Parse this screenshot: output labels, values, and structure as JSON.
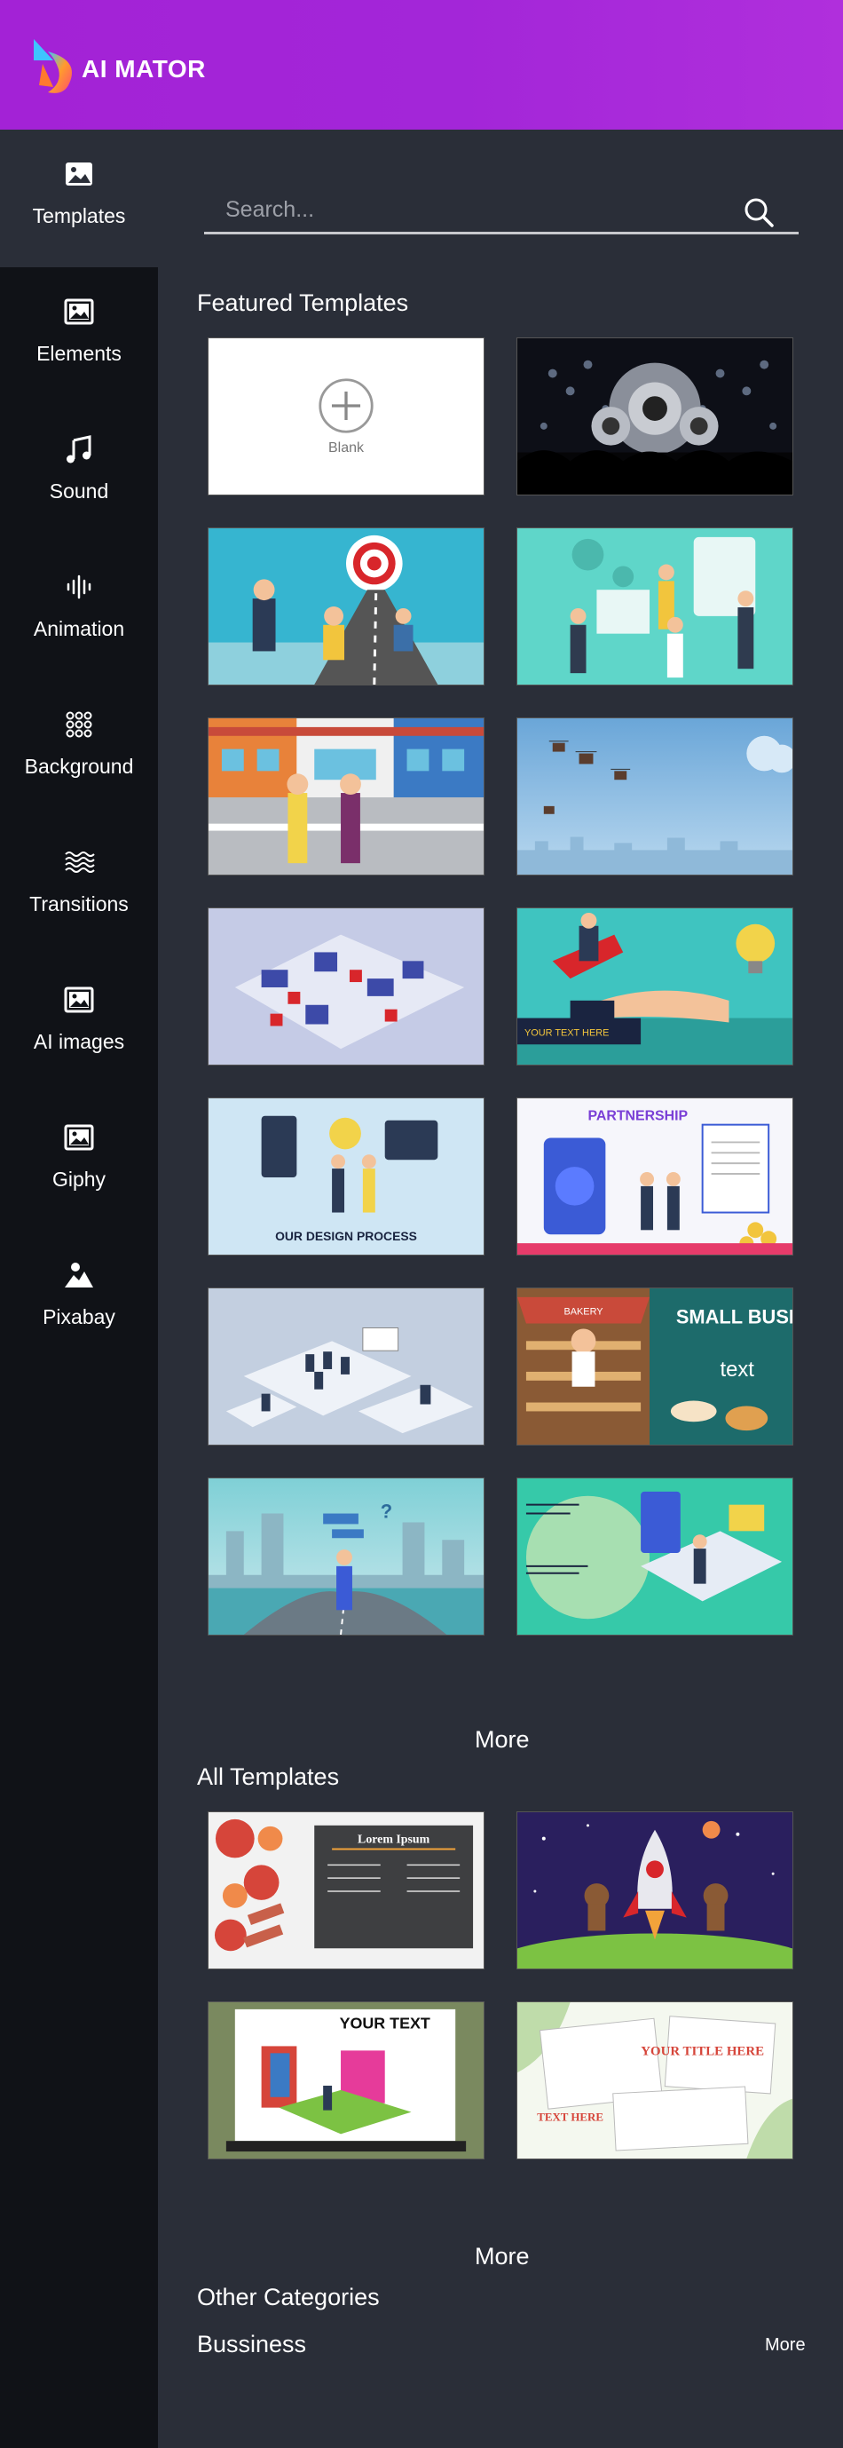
{
  "app": {
    "logo_text": "AI MATOR"
  },
  "sidebar": {
    "items": [
      {
        "label": "Templates",
        "icon": "image-icon"
      },
      {
        "label": "Elements",
        "icon": "image-icon"
      },
      {
        "label": "Sound",
        "icon": "music-note-icon"
      },
      {
        "label": "Animation",
        "icon": "waveform-icon"
      },
      {
        "label": "Background",
        "icon": "dots-grid-icon"
      },
      {
        "label": "Transitions",
        "icon": "waves-icon"
      },
      {
        "label": "AI images",
        "icon": "image-icon"
      },
      {
        "label": "Giphy",
        "icon": "image-icon"
      },
      {
        "label": "Pixabay",
        "icon": "landscape-icon"
      }
    ]
  },
  "search": {
    "placeholder": "Search..."
  },
  "featured": {
    "title": "Featured Templates",
    "blank_label": "Blank",
    "more_label": "More"
  },
  "all_templates": {
    "title": "All Templates",
    "more_label": "More",
    "card_texts": {
      "lorem": "Lorem Ipsum",
      "your_text": "YOUR TEXT",
      "your_title": "YOUR TITLE HERE",
      "text_here": "TEXT HERE"
    }
  },
  "featured_texts": {
    "your_text_here": "YOUR TEXT HERE",
    "design_process": "OUR DESIGN PROCESS",
    "partnership": "PARTNERSHIP",
    "small_business": "SMALL BUSINESS",
    "text": "text",
    "bakery": "BAKERY"
  },
  "other": {
    "title": "Other Categories",
    "category": "Bussiness",
    "more_label": "More"
  },
  "colors": {
    "header": "#a322d6",
    "sidebar": "#101217",
    "main": "#2a2e38"
  }
}
